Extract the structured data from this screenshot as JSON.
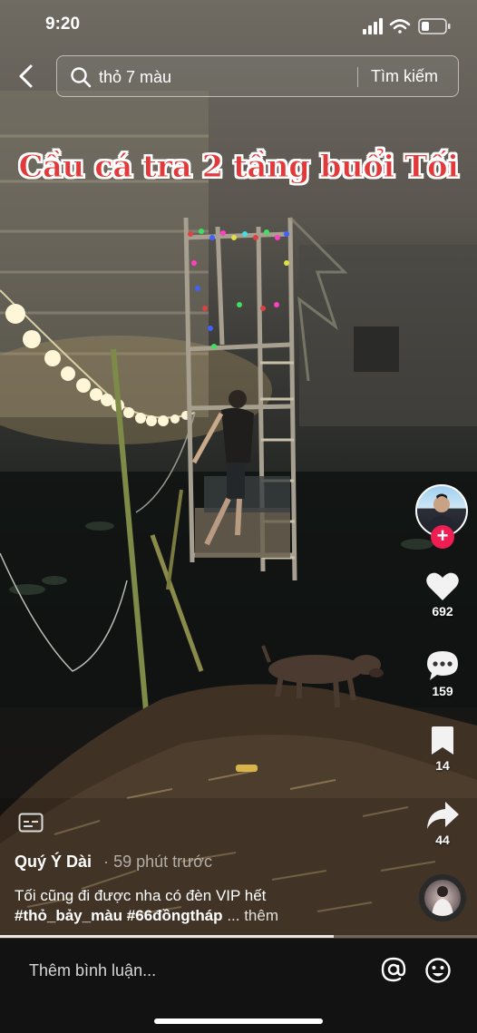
{
  "status_bar": {
    "time": "9:20"
  },
  "search": {
    "value": "thỏ 7 màu",
    "button_label": "Tìm kiếm"
  },
  "video": {
    "caption": "Cầu cá tra 2 tầng buổi Tối"
  },
  "actions": {
    "likes": "692",
    "comments": "159",
    "saves": "14",
    "shares": "44",
    "follow_symbol": "+"
  },
  "post": {
    "author": "Quý Ý Dài",
    "separator": "·",
    "time": "59 phút trước",
    "description": "Tối cũng đi được nha có đèn VIP hết",
    "hashtags": [
      "#thỏ_bảy_màu",
      "#66đồngtháp"
    ],
    "more_label": "... thêm"
  },
  "comment_bar": {
    "placeholder": "Thêm bình luận..."
  },
  "playback": {
    "progress": 0.7
  },
  "colors": {
    "follow": "#ee1d52",
    "caption": "#e23a3a"
  }
}
